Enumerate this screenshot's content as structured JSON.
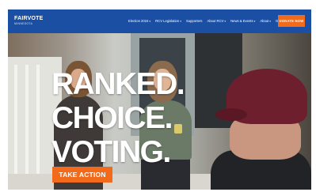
{
  "header": {
    "logo": {
      "main": "FAIRVOTE",
      "sub": "MINNESOTA"
    },
    "nav": [
      {
        "label": "Election 2024",
        "dropdown": true
      },
      {
        "label": "RCV Legislation",
        "dropdown": true
      },
      {
        "label": "Supporters",
        "dropdown": false
      },
      {
        "label": "About RCV",
        "dropdown": true
      },
      {
        "label": "News & Events",
        "dropdown": true
      },
      {
        "label": "About",
        "dropdown": true
      },
      {
        "label": "Get Involved",
        "dropdown": true
      }
    ],
    "donate_label": "DONATE NOW"
  },
  "hero": {
    "headline": [
      "RANKED.",
      "CHOICE.",
      "VOTING."
    ],
    "cta_label": "TAKE ACTION"
  },
  "colors": {
    "nav_bg": "#1a4fa3",
    "accent_orange": "#f26b1d",
    "text_white": "#ffffff"
  },
  "icons": {
    "dropdown": "chevron-down-icon"
  }
}
